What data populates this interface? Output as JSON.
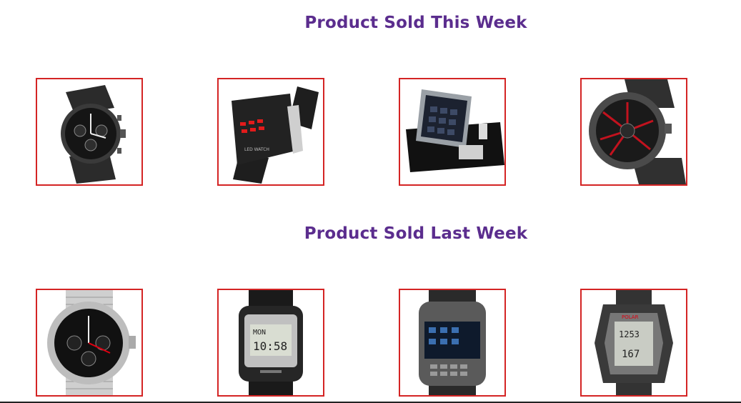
{
  "sections": [
    {
      "title": "Product Sold This Week",
      "products": [
        {
          "icon": "pilot-chronograph-watch-icon"
        },
        {
          "icon": "led-watch-icon"
        },
        {
          "icon": "touchscreen-phone-watch-icon"
        },
        {
          "icon": "turbine-sport-watch-icon"
        }
      ]
    },
    {
      "title": "Product Sold Last Week",
      "products": [
        {
          "icon": "steel-chronograph-watch-icon"
        },
        {
          "icon": "digital-databank-watch-icon"
        },
        {
          "icon": "keypad-phone-watch-icon"
        },
        {
          "icon": "polar-heart-rate-watch-icon"
        }
      ]
    }
  ],
  "colors": {
    "title": "#5b2d8e",
    "card_border": "#d42424",
    "led_red": "#e21b1b"
  }
}
